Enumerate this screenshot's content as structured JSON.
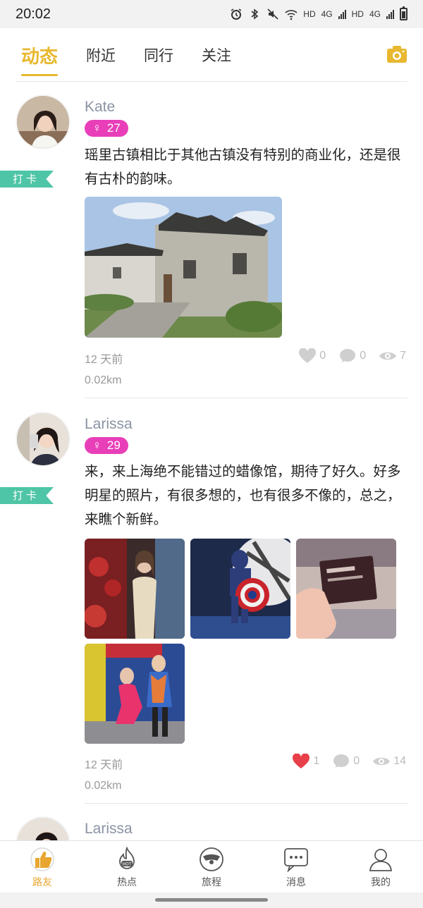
{
  "status_bar": {
    "time": "20:02",
    "hd1": "HD",
    "net1": "4G",
    "hd2": "HD",
    "net2": "4G"
  },
  "top_tabs": [
    {
      "label": "动态",
      "active": true
    },
    {
      "label": "附近",
      "active": false
    },
    {
      "label": "同行",
      "active": false
    },
    {
      "label": "关注",
      "active": false
    }
  ],
  "posts": [
    {
      "username": "Kate",
      "gender_symbol": "♀",
      "age": "27",
      "checkin": "打卡",
      "content": "瑶里古镇相比于其他古镇没有特别的商业化，还是很有古朴的韵味。",
      "time": "12 天前",
      "distance": "0.02km",
      "likes": "0",
      "comments": "0",
      "views": "7",
      "liked": false
    },
    {
      "username": "Larissa",
      "gender_symbol": "♀",
      "age": "29",
      "checkin": "打卡",
      "content": "来，来上海绝不能错过的蜡像馆，期待了好久。好多明星的照片，有很多想的，也有很多不像的，总之，来瞧个新鲜。",
      "time": "12 天前",
      "distance": "0.02km",
      "likes": "1",
      "comments": "0",
      "views": "14",
      "liked": true
    },
    {
      "username": "Larissa"
    }
  ],
  "bottom_nav": [
    {
      "label": "路友",
      "icon": "thumbs-up-icon",
      "active": true
    },
    {
      "label": "热点",
      "icon": "hot-flame-icon",
      "active": false
    },
    {
      "label": "旅程",
      "icon": "journey-icon",
      "active": false
    },
    {
      "label": "消息",
      "icon": "message-icon",
      "active": false
    },
    {
      "label": "我的",
      "icon": "profile-icon",
      "active": false
    }
  ],
  "colors": {
    "accent": "#e8b830",
    "badge": "#e83fb8",
    "checkin": "#4ec5a6",
    "like_active": "#e8404a"
  }
}
